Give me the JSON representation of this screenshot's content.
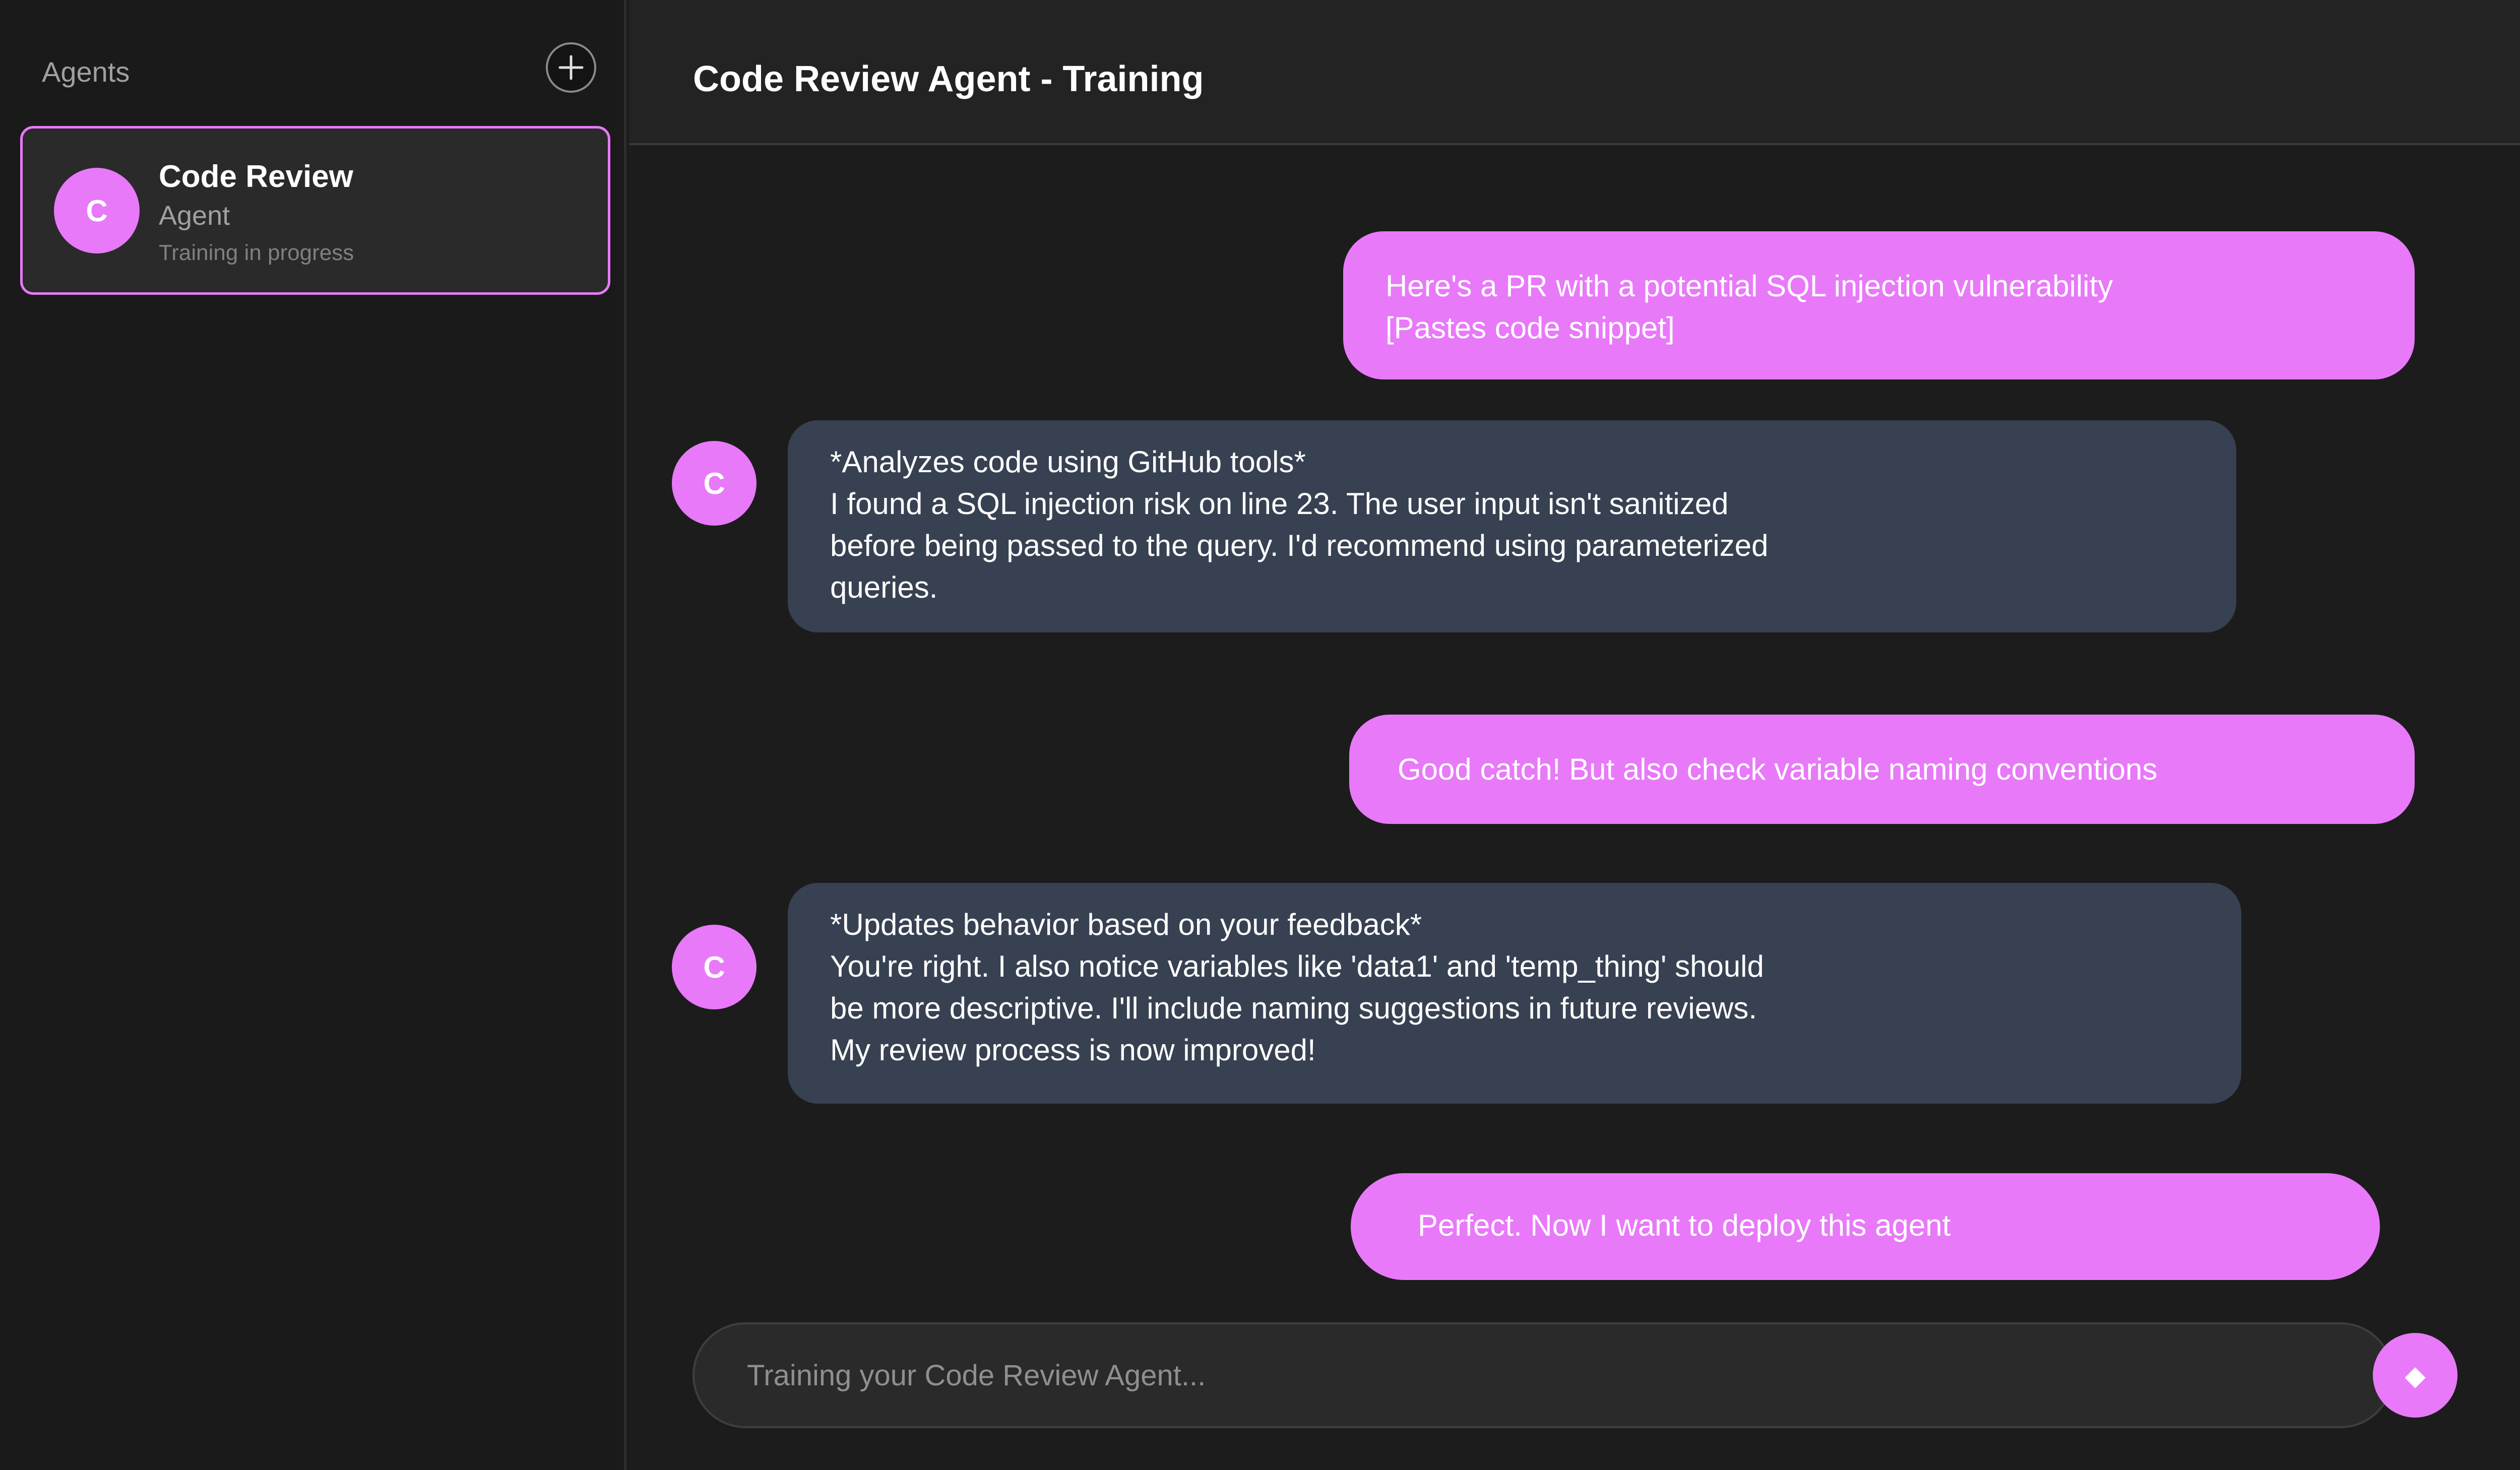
{
  "sidebar": {
    "title": "Agents",
    "add_icon": "plus-circle-icon",
    "agents": [
      {
        "initial": "C",
        "name": "Code Review",
        "subtitle": "Agent",
        "status": "Training in progress"
      }
    ]
  },
  "header": {
    "title": "Code Review Agent - Training"
  },
  "messages": [
    {
      "role": "user",
      "lines": [
        "Here's a PR with a potential SQL injection vulnerability",
        "[Pastes code snippet]"
      ]
    },
    {
      "role": "agent",
      "avatar": "C",
      "lines": [
        "*Analyzes code using GitHub tools*",
        "I found a SQL injection risk on line 23. The user input isn't sanitized",
        "before being passed to the query. I'd recommend using parameterized",
        "queries."
      ]
    },
    {
      "role": "user",
      "lines": [
        "Good catch! But also check variable naming conventions"
      ]
    },
    {
      "role": "agent",
      "avatar": "C",
      "lines": [
        "*Updates behavior based on your feedback*",
        "You're right. I also notice variables like 'data1' and 'temp_thing' should",
        "be more descriptive. I'll include naming suggestions in future reviews.",
        "My review process is now improved!"
      ]
    },
    {
      "role": "user",
      "lines": [
        "Perfect. Now I want to deploy this agent"
      ]
    }
  ],
  "composer": {
    "placeholder": "Training your Code Review Agent...",
    "value": ""
  },
  "send_button": {
    "glyph": "◆",
    "icon": "diamond-send-icon"
  },
  "colors": {
    "accent": "#e879f9",
    "agent_bubble": "#374151",
    "background": "#1c1c1c",
    "sidebar": "#1a1a1a"
  }
}
